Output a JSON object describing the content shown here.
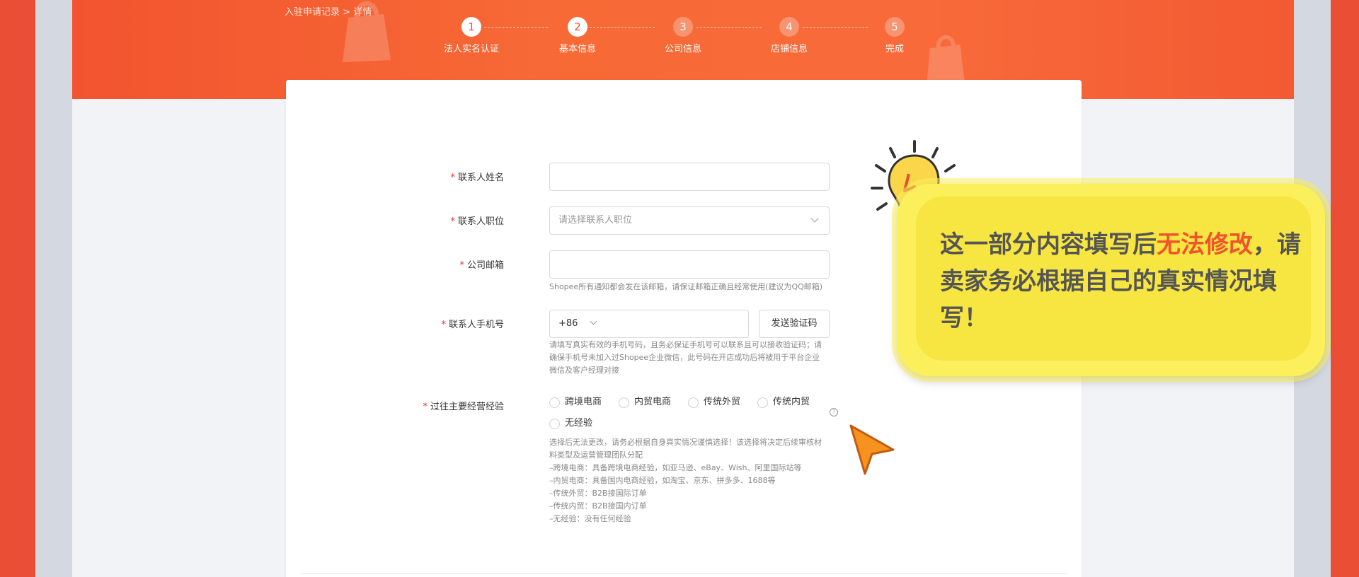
{
  "breadcrumb": {
    "parent": "入驻申请记录",
    "separator": ">",
    "current": "详情"
  },
  "steps": [
    {
      "num": "1",
      "label": "法人实名认证",
      "state": "done"
    },
    {
      "num": "2",
      "label": "基本信息",
      "state": "done"
    },
    {
      "num": "3",
      "label": "公司信息",
      "state": "todo"
    },
    {
      "num": "4",
      "label": "店铺信息",
      "state": "todo"
    },
    {
      "num": "5",
      "label": "完成",
      "state": "todo"
    }
  ],
  "form": {
    "required_mark": "*",
    "contact_name": {
      "label": "联系人姓名",
      "value": ""
    },
    "contact_position": {
      "label": "联系人职位",
      "placeholder": "请选择联系人职位"
    },
    "company_email": {
      "label": "公司邮箱",
      "value": "",
      "hint": "Shopee所有通知都会发在该邮箱，请保证邮箱正确且经常使用(建议为QQ邮箱)"
    },
    "contact_phone": {
      "label": "联系人手机号",
      "country_code": "+86",
      "send_code_button": "发送验证码",
      "hint_lines": [
        "请填写真实有效的手机号码，且务必保证手机号可以联系且可以接收验证码；请",
        "确保手机号未加入过Shopee企业微信，此号码在开店成功后将被用于平台企业",
        "微信及客户经理对接"
      ]
    },
    "experience": {
      "label": "过往主要经营经验",
      "help_icon": "?",
      "options": [
        "跨境电商",
        "内贸电商",
        "传统外贸",
        "传统内贸",
        "无经验"
      ],
      "notes": [
        "选择后无法更改，请务必根据自身真实情况谨慎选择！该选择将决定后续审核材",
        "料类型及运营管理团队分配",
        "–跨境电商：具备跨境电商经验，如亚马逊、eBay、Wish、阿里国际站等",
        "–内贸电商：具备国内电商经验，如淘宝、京东、拼多多、1688等",
        "–传统外贸：B2B接国际订单",
        "–传统内贸：B2B接国内订单",
        "–无经验：没有任何经验"
      ]
    }
  },
  "callout": {
    "text_before": "这一部分内容填写后",
    "highlight": "无法修改",
    "text_after": "，请卖家务必根据自己的真实情况填写！"
  },
  "colors": {
    "brand_orange": "#f0532d",
    "callout_yellow": "#f7e641",
    "required_red": "#ee2b2b"
  },
  "icons": [
    "shopping-bag-icon",
    "lightbulb-icon",
    "cursor-pointer-icon",
    "chevron-down-icon",
    "help-icon"
  ]
}
